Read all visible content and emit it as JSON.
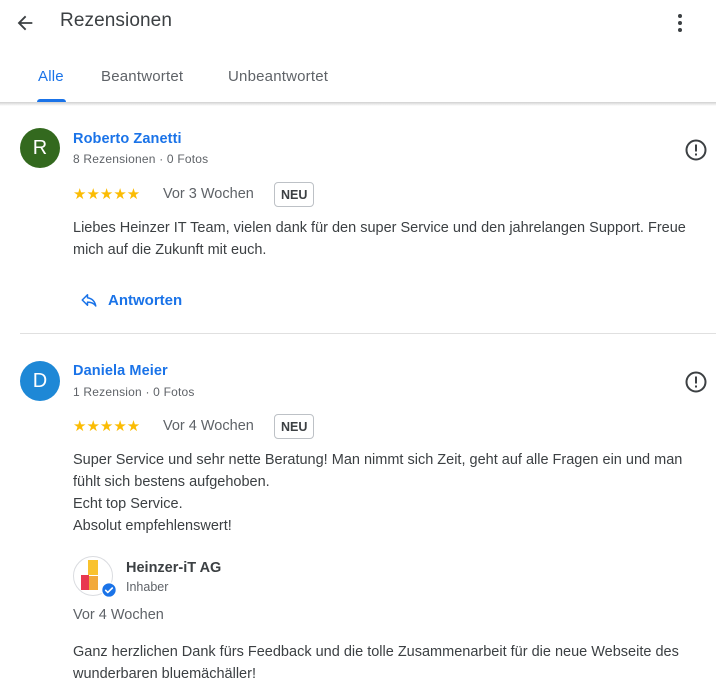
{
  "header": {
    "title": "Rezensionen",
    "back_icon": "arrow-back-icon",
    "menu_icon": "more-vert-icon"
  },
  "tabs": [
    {
      "label": "Alle",
      "active": true
    },
    {
      "label": "Beantwortet",
      "active": false
    },
    {
      "label": "Unbeantwortet",
      "active": false
    }
  ],
  "colors": {
    "accent": "#1a73e8",
    "star": "#fbbc04",
    "avatar_r": "#33691e",
    "avatar_d": "#1e88d6"
  },
  "reviews": [
    {
      "avatar_letter": "R",
      "name": "Roberto Zanetti",
      "meta": "8 Rezensionen · 0 Fotos",
      "stars": "★★★★★",
      "rating": 5,
      "time": "Vor 3 Wochen",
      "badge": "NEU",
      "text": "Liebes Heinzer IT Team, vielen dank für den super Service und den jahrelangen Support. Freue mich auf die Zukunft mit euch.",
      "reply_label": "Antworten"
    },
    {
      "avatar_letter": "D",
      "name": "Daniela Meier",
      "meta": "1 Rezension · 0 Fotos",
      "stars": "★★★★★",
      "rating": 5,
      "time": "Vor 4 Wochen",
      "badge": "NEU",
      "text_lines": [
        "Super Service und sehr nette Beratung! Man nimmt sich Zeit, geht auf alle Fragen ein und man fühlt sich bestens aufgehoben.",
        "Echt top Service.",
        "Absolut empfehlenswert!"
      ],
      "owner_reply": {
        "name": "Heinzer-iT AG",
        "role": "Inhaber",
        "time": "Vor 4 Wochen",
        "text": "Ganz herzlichen Dank fürs Feedback und die tolle Zusammenarbeit für die neue Webseite des wunderbaren bluemächäller!"
      }
    }
  ]
}
